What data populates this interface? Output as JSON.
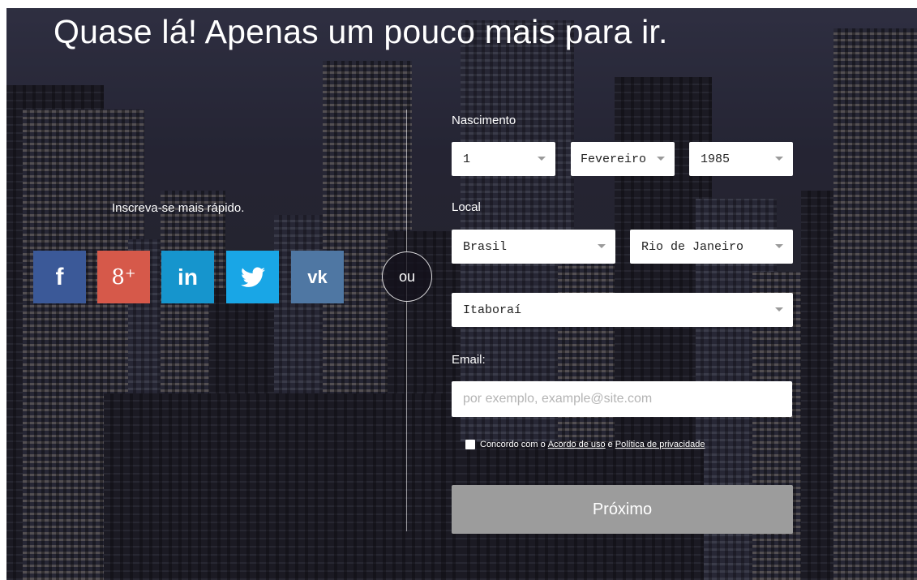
{
  "header": {
    "title": "Quase lá! Apenas um pouco mais para ir."
  },
  "social": {
    "label": "Inscreva-se mais rápido.",
    "buttons": [
      {
        "name": "facebook",
        "glyph": "f",
        "color": "#3b5998"
      },
      {
        "name": "google-plus",
        "glyph": "8⁺",
        "color": "#d6594a"
      },
      {
        "name": "linkedin",
        "glyph": "in",
        "color": "#1695cd"
      },
      {
        "name": "twitter",
        "glyph": "🐦",
        "color": "#19a6e6"
      },
      {
        "name": "vk",
        "glyph": "vk",
        "color": "#4f77a3"
      }
    ]
  },
  "divider": {
    "text": "ou"
  },
  "form": {
    "birth_label": "Nascimento",
    "birth_day": "1",
    "birth_month": "Fevereiro",
    "birth_year": "1985",
    "location_label": "Local",
    "country": "Brasil",
    "state": "Rio de Janeiro",
    "city": "Itaboraí",
    "email_label": "Email:",
    "email_placeholder": "por exemplo, example@site.com",
    "email_value": "",
    "agree_prefix": "Concordo com o",
    "agree_terms": "Acordo de uso",
    "agree_conj": "e",
    "agree_privacy": "Política de privacidade",
    "agree_checked": false,
    "submit_label": "Próximo"
  },
  "colors": {
    "submit_bg": "#9c9c9c",
    "facebook": "#3b5998",
    "google_plus": "#d6594a",
    "linkedin": "#1695cd",
    "twitter": "#19a6e6",
    "vk": "#4f77a3"
  }
}
